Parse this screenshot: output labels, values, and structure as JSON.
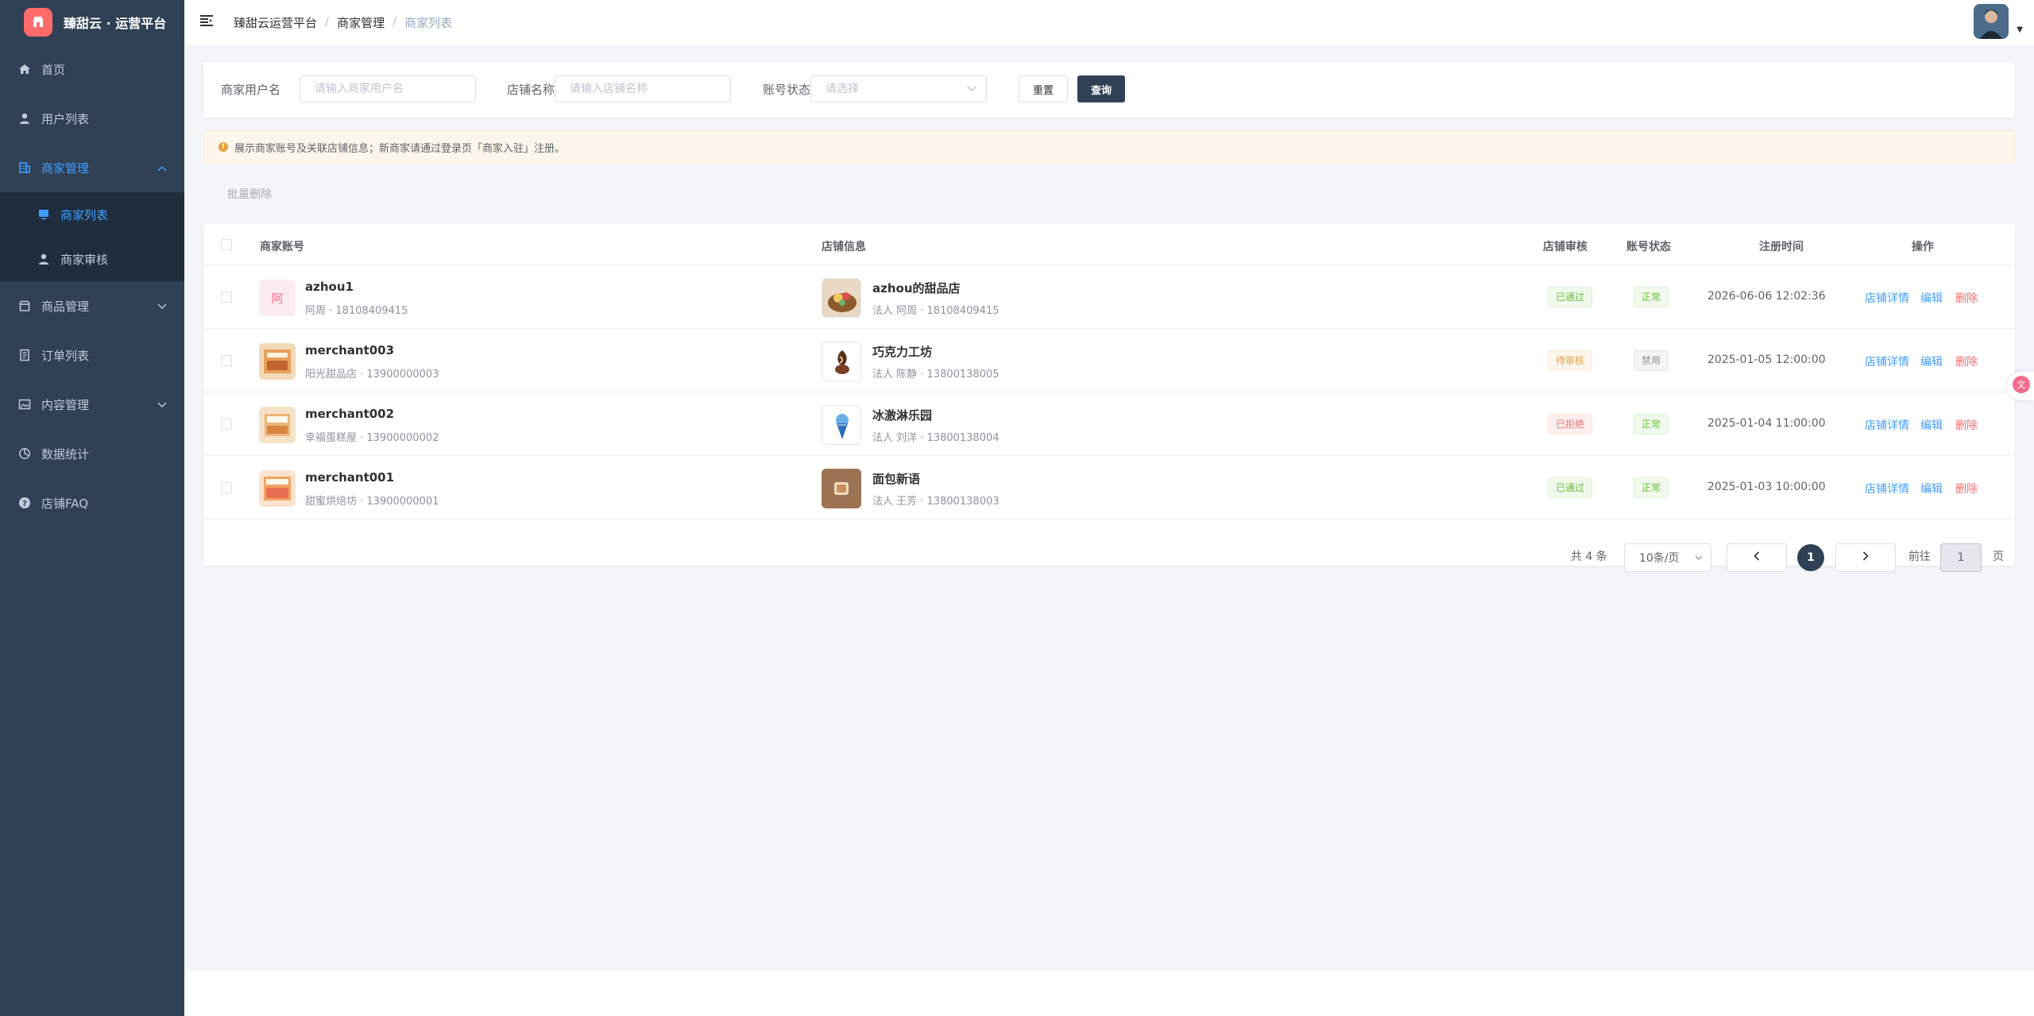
{
  "brand": {
    "title": "臻甜云 · 运营平台"
  },
  "sidebar": {
    "items": [
      {
        "label": "首页",
        "icon": "home-icon"
      },
      {
        "label": "用户列表",
        "icon": "user-icon"
      },
      {
        "label": "商家管理",
        "icon": "building-icon",
        "expanded": true
      },
      {
        "label": "商家列表",
        "icon": "monitor-icon",
        "active": true
      },
      {
        "label": "商家审核",
        "icon": "user-icon"
      },
      {
        "label": "商品管理",
        "icon": "shop-icon"
      },
      {
        "label": "订单列表",
        "icon": "document-icon"
      },
      {
        "label": "内容管理",
        "icon": "picture-icon"
      },
      {
        "label": "数据统计",
        "icon": "pie-chart-icon"
      },
      {
        "label": "店铺FAQ",
        "icon": "question-icon"
      }
    ]
  },
  "breadcrumb": [
    "臻甜云运营平台",
    "商家管理",
    "商家列表"
  ],
  "search": {
    "username_label": "商家用户名",
    "username_placeholder": "请输入商家用户名",
    "shop_label": "店铺名称",
    "shop_placeholder": "请输入店铺名称",
    "status_label": "账号状态",
    "status_placeholder": "请选择",
    "reset": "重置",
    "query": "查询"
  },
  "notice": "展示商家账号及关联店铺信息；新商家请通过登录页「商家入驻」注册。",
  "batch_delete": "批量删除",
  "table": {
    "headers": {
      "account": "商家账号",
      "shop": "店铺信息",
      "audit": "店铺审核",
      "status": "账号状态",
      "time": "注册时间",
      "ops": "操作"
    },
    "rows": [
      {
        "account": "azhou1",
        "account_sub": "阿周 · 18108409415",
        "avatar_text": "阿",
        "shop": "azhou的甜品店",
        "shop_sub": "法人 阿周 · 18108409415",
        "audit": "已通过",
        "status": "正常",
        "time": "2026-06-06 12:02:36"
      },
      {
        "account": "merchant003",
        "account_sub": "阳光甜品店 · 13900000003",
        "shop": "巧克力工坊",
        "shop_sub": "法人 陈静 · 13800138005",
        "audit": "待审核",
        "status": "禁用",
        "time": "2025-01-05 12:00:00"
      },
      {
        "account": "merchant002",
        "account_sub": "幸福蛋糕屋 · 13900000002",
        "shop": "冰激淋乐园",
        "shop_sub": "法人 刘洋 · 13800138004",
        "audit": "已拒绝",
        "status": "正常",
        "time": "2025-01-04 11:00:00"
      },
      {
        "account": "merchant001",
        "account_sub": "甜蜜烘焙坊 · 13900000001",
        "shop": "面包新语",
        "shop_sub": "法人 王芳 · 13800138003",
        "audit": "已通过",
        "status": "正常",
        "time": "2025-01-03 10:00:00"
      }
    ],
    "ops": {
      "detail": "店铺详情",
      "edit": "编辑",
      "delete": "删除"
    }
  },
  "pagination": {
    "total": "共 4 条",
    "page_size": "10条/页",
    "current": "1",
    "goto_prefix": "前往",
    "goto_value": "1",
    "goto_suffix": "页"
  },
  "colors": {
    "sidebar": "#304156",
    "accent": "#409eff",
    "primary_button": "#304156",
    "danger": "#f56c6c",
    "success": "#67c23a",
    "warning": "#e6a23c"
  }
}
